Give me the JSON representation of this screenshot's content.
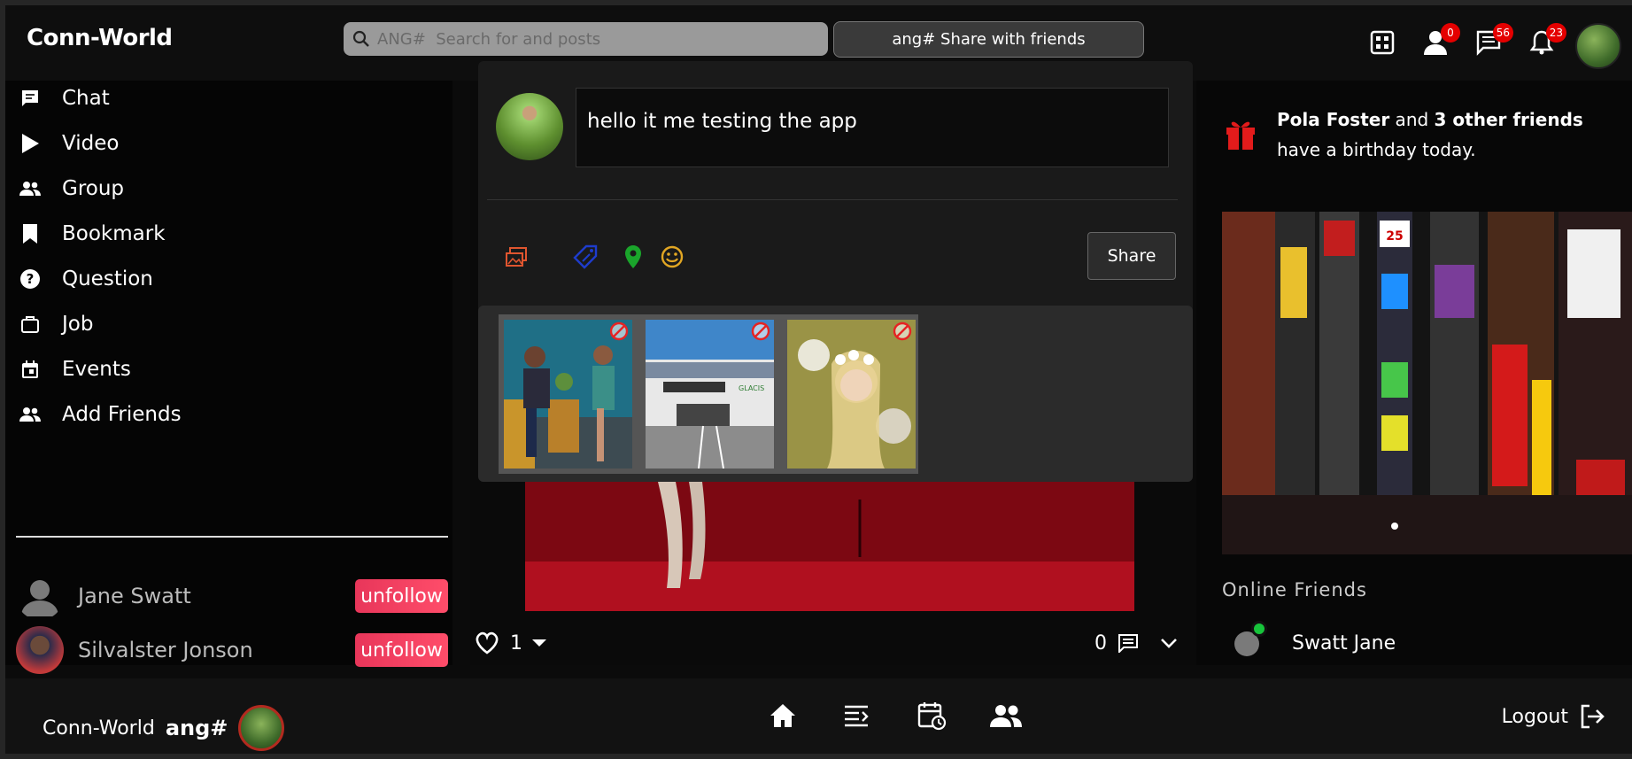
{
  "app": {
    "brand": "Conn-World"
  },
  "topbar": {
    "search_placeholder": "ANG#  Search for and posts",
    "share_button": "ang# Share with friends",
    "friend_requests_count": "0",
    "messages_count": "56",
    "notifications_count": "23"
  },
  "sidebar": {
    "items": [
      {
        "label": "Chat",
        "icon": "chat-icon"
      },
      {
        "label": "Video",
        "icon": "play-icon"
      },
      {
        "label": "Group",
        "icon": "group-icon"
      },
      {
        "label": "Bookmark",
        "icon": "bookmark-icon"
      },
      {
        "label": "Question",
        "icon": "question-icon"
      },
      {
        "label": "Job",
        "icon": "briefcase-icon"
      },
      {
        "label": "Events",
        "icon": "calendar-icon"
      },
      {
        "label": "Add Friends",
        "icon": "add-friends-icon"
      }
    ],
    "friends": [
      {
        "name": "Jane  Swatt",
        "action": "unfollow"
      },
      {
        "name": "Silvalster  Jonson",
        "action": "unfollow"
      }
    ]
  },
  "composer": {
    "text": "hello it me testing the app",
    "share_button": "Share",
    "tools": [
      "gallery-icon",
      "tag-icon",
      "location-icon",
      "emoji-icon"
    ],
    "preview_images": [
      "meeting-photo",
      "building-photo",
      "flower-girl-photo"
    ]
  },
  "post": {
    "likes": "1",
    "comments": "0"
  },
  "right": {
    "birthday": {
      "name": "Pola Foster",
      "middle": " and ",
      "others": "3 other friends",
      "suffix": " have a birthday today."
    },
    "online_title": "Online Friends",
    "online_friends": [
      {
        "name": "Swatt Jane"
      }
    ]
  },
  "bottombar": {
    "brand": "Conn-World",
    "username": "ang#",
    "logout": "Logout"
  },
  "colors": {
    "badge": "#e40000",
    "unfollow": "#ff4d6a",
    "online": "#17c43b"
  }
}
